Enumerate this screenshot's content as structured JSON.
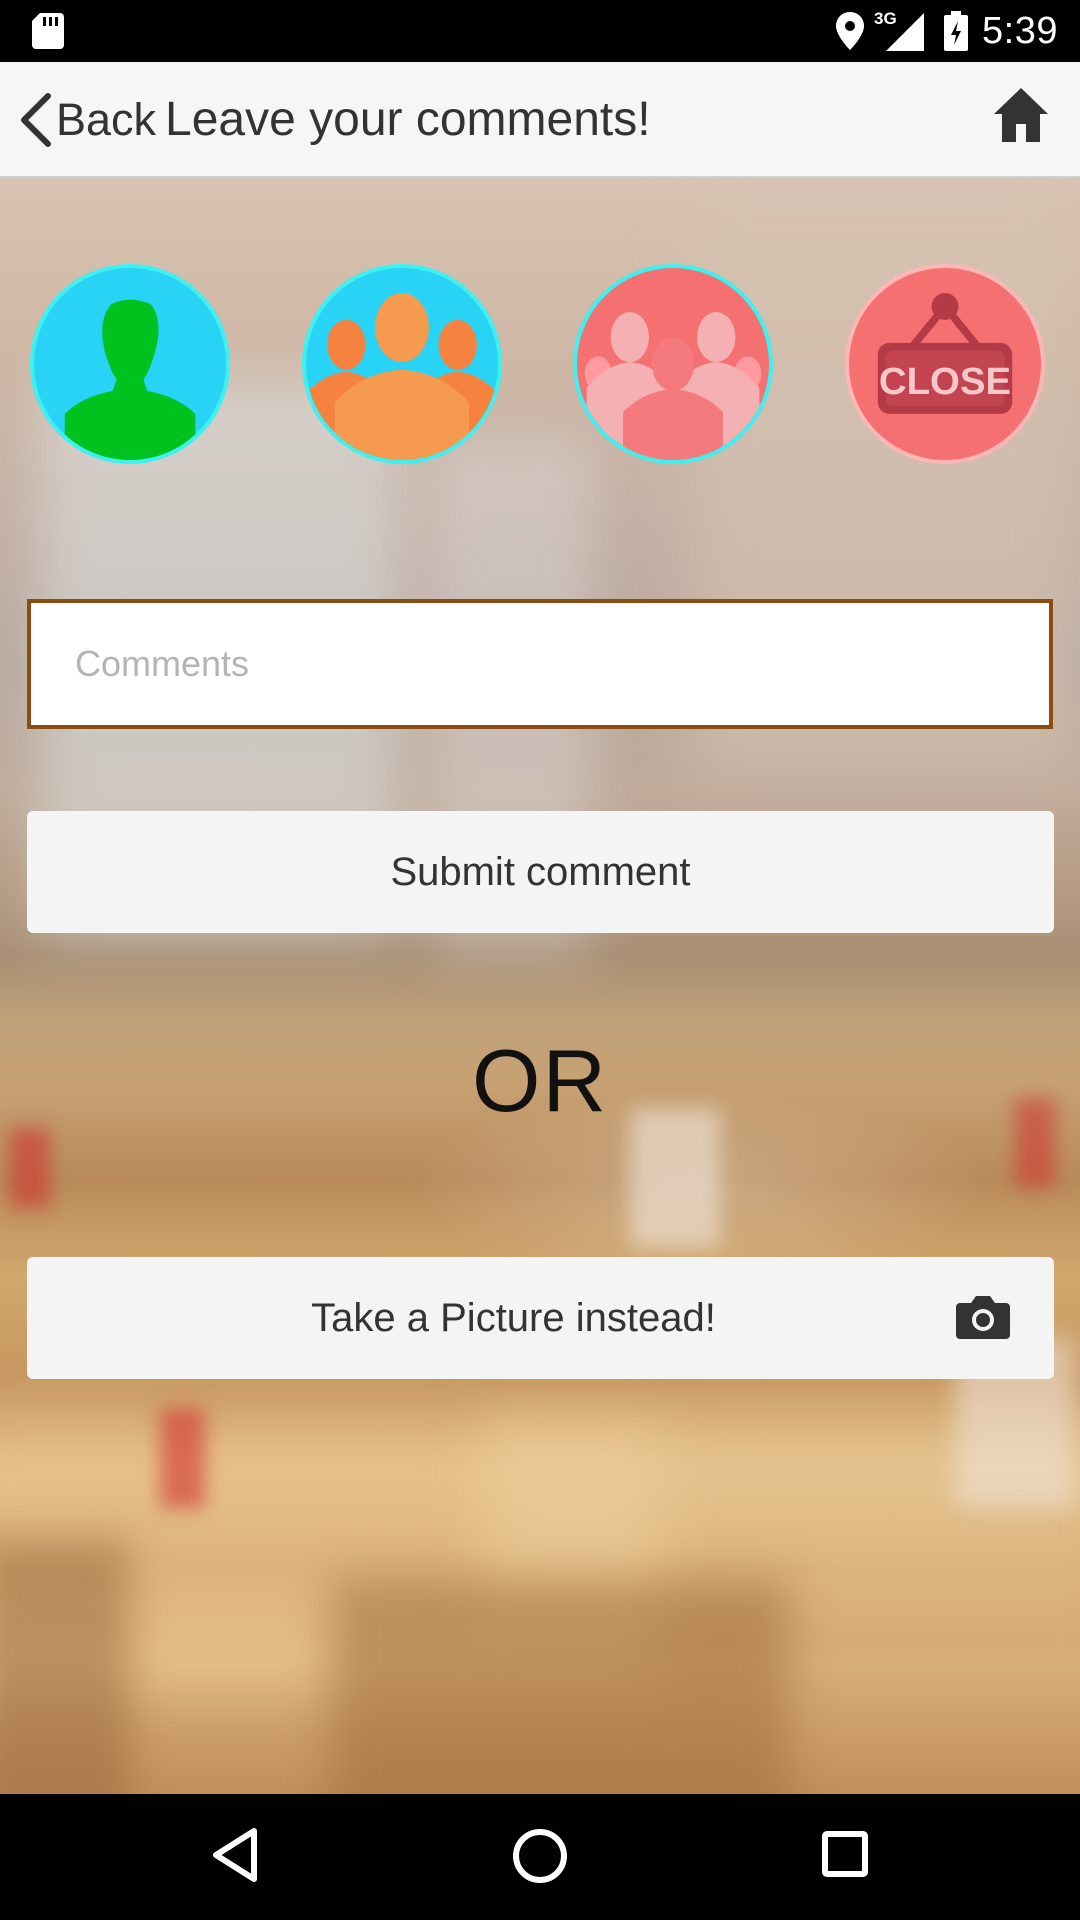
{
  "status_bar": {
    "network": "3G",
    "time": "5:39",
    "icons": [
      "sd-card-icon",
      "location-icon",
      "signal-icon",
      "battery-icon"
    ]
  },
  "app_bar": {
    "back_label": "Back",
    "title": "Leave your comments!",
    "icons": [
      "chevron-left-icon",
      "home-icon"
    ]
  },
  "avatars": [
    {
      "name": "single-person-icon",
      "border": "#3ff0f0",
      "fill": "#29d3f6",
      "figure": "#00c21e"
    },
    {
      "name": "group-icon",
      "border": "#3ff0f0",
      "fill": "#29d3f6",
      "figure": "#f59a4f"
    },
    {
      "name": "crowd-icon",
      "border": "#3ff0f0",
      "fill": "#f47071",
      "figure": "#f5b0b3"
    },
    {
      "name": "close-sign-icon",
      "border": "#ffb6b6",
      "fill": "#f47071",
      "sign_text": "CLOSE"
    }
  ],
  "comments": {
    "placeholder": "Comments",
    "value": ""
  },
  "submit_label": "Submit comment",
  "or_label": "OR",
  "picture_label": "Take a Picture instead!",
  "nav_bar": {
    "icons": [
      "back-triangle-icon",
      "home-circle-icon",
      "recents-square-icon"
    ]
  },
  "colors": {
    "field_border": "#8c4d12",
    "button_bg": "#f4f4f4",
    "app_bar_bg": "#f6f6f6"
  }
}
